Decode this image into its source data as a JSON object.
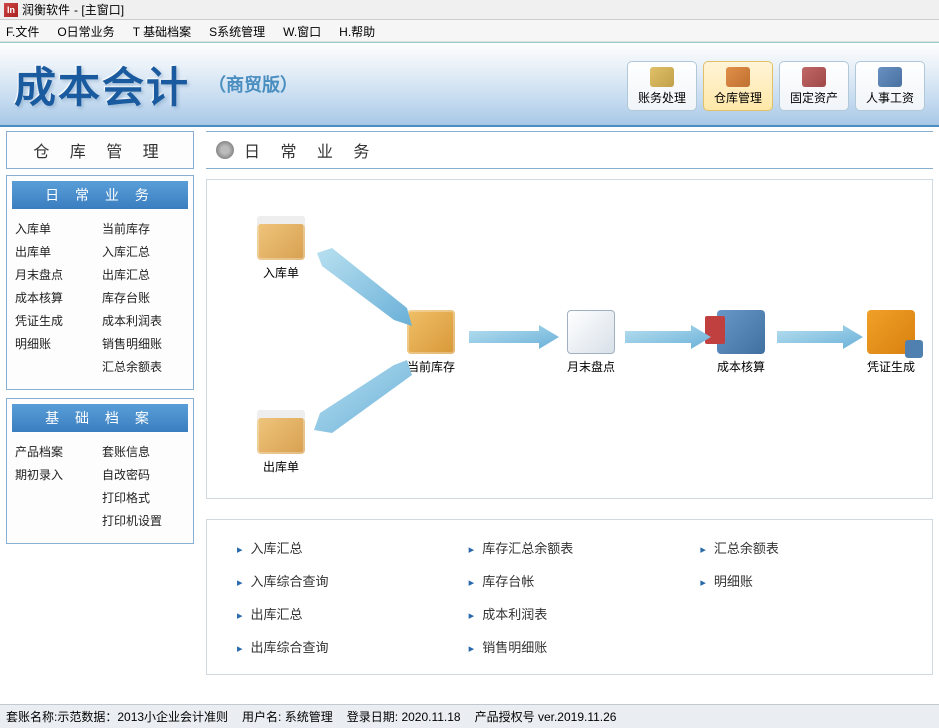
{
  "window": {
    "app": "润衡软件",
    "title": "[主窗口]"
  },
  "menu": [
    "F.文件",
    "O日常业务",
    "T 基础档案",
    "S系统管理",
    "W.窗口",
    "H.帮助"
  ],
  "header": {
    "title": "成本会计",
    "subtitle": "（商贸版）",
    "buttons": [
      {
        "label": "账务处理",
        "active": false
      },
      {
        "label": "仓库管理",
        "active": true
      },
      {
        "label": "固定资产",
        "active": false
      },
      {
        "label": "人事工资",
        "active": false
      }
    ]
  },
  "sidebar": {
    "title": "仓 库 管 理",
    "groups": [
      {
        "header": "日 常 业 务",
        "items": [
          "入库单",
          "当前库存",
          "出库单",
          "入库汇总",
          "月末盘点",
          "出库汇总",
          "成本核算",
          "库存台账",
          "凭证生成",
          "成本利润表",
          "明细账",
          "销售明细账",
          "",
          "汇总余额表"
        ]
      },
      {
        "header": "基 础 档 案",
        "items": [
          "产品档案",
          "套账信息",
          "期初录入",
          "自改密码",
          "",
          "打印格式",
          "",
          "打印机设置"
        ]
      }
    ]
  },
  "content": {
    "title": "日 常 业 务",
    "nodes": {
      "n1": "入库单",
      "n2": "当前库存",
      "n3": "出库单",
      "n4": "月末盘点",
      "n5": "成本核算",
      "n6": "凭证生成"
    },
    "links": [
      "入库汇总",
      "库存汇总余额表",
      "汇总余额表",
      "入库综合查询",
      "库存台帐",
      "明细账",
      "出库汇总",
      "成本利润表",
      "",
      "出库综合查询",
      "销售明细账",
      ""
    ]
  },
  "status": {
    "account_label": "套账名称:",
    "account": "示范数据：2013小企业会计准则",
    "user_label": "用户名:",
    "user": "系统管理",
    "login_label": "登录日期:",
    "login": "2020.11.18",
    "lic_label": "产品授权号",
    "lic": "ver.2019.11.26"
  }
}
